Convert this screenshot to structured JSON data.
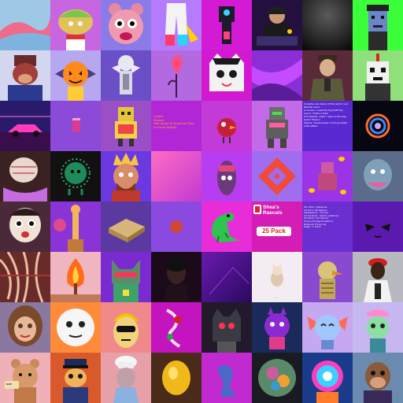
{
  "colors": {
    "background": "#1a1027",
    "magenta": "#c218d9",
    "purple": "#7a3cd6",
    "pink": "#ff4fd8",
    "blue": "#2a63ff"
  },
  "tiles": {
    "r3c3": {
      "lines": [
        "Cryptic",
        "Shaayo",
        "",
        "with power of Quantum Pass",
        "in Purple Robots"
      ]
    },
    "r3c6": {
      "lines": [
        "Consider are owner of the land in our Panther Land",
        "to Ocean. I read the big draft the sound. That's a total",
        "bird weekly, night. I was on the way back? There's",
        "tagline. Cause below I hold up ballet snow effect."
      ]
    },
    "r5c6": {
      "title_line1": "Shea's",
      "title_line2": "Rascals",
      "pack_label": "25 Pack"
    },
    "r5c7": {
      "lines": [
        "The Eskin Sequences",
        "Cofnetic Parameters",
        "Subsequence: Initial",
        "Calibration: Gentle wobbling",
        "Chromatic Variations",
        "Origin/Stream/Chromatics",
        "Enhanced Filtering",
        "Stage: 3 Pilot"
      ]
    },
    "r6c5": {
      "caption": "•"
    },
    "r7c0": {
      "badge": "DAP"
    }
  }
}
